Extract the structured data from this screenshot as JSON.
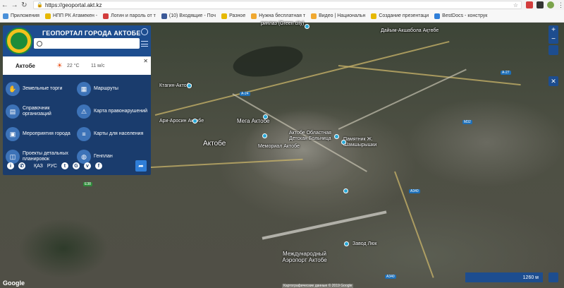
{
  "browser": {
    "url": "https://geoportal.akt.kz",
    "bookmarks": [
      {
        "label": "Приложения",
        "color": "#4a90d9"
      },
      {
        "label": "НПП РК Атамекен -",
        "color": "#e6b800"
      },
      {
        "label": "Логин и пароль от т",
        "color": "#d23c3c"
      },
      {
        "label": "(10) Входящие - Поч",
        "color": "#3b5998"
      },
      {
        "label": "Разное",
        "color": "#e6b800"
      },
      {
        "label": "Нужна бесплатная т",
        "color": "#f0a830"
      },
      {
        "label": "Видео | Национальн",
        "color": "#f0a830"
      },
      {
        "label": "Создание презентаци",
        "color": "#e6b800"
      },
      {
        "label": "BestDocs - конструк",
        "color": "#2f7ed8"
      }
    ]
  },
  "panel": {
    "title": "ГЕОПОРТАЛ ГОРОДА АКТОБЕ",
    "search_placeholder": "",
    "weather": {
      "city": "Актобе",
      "temp": "22 °C",
      "wind": "11 м/с"
    },
    "menu": [
      {
        "label": "Земельные торги",
        "icon": "hand-icon"
      },
      {
        "label": "Маршруты",
        "icon": "map-icon"
      },
      {
        "label": "Справочник организаций",
        "icon": "book-icon"
      },
      {
        "label": "Карта правонарушений",
        "icon": "warning-icon"
      },
      {
        "label": "Мероприятия города",
        "icon": "calendar-icon"
      },
      {
        "label": "Карты для населения",
        "icon": "list-icon"
      },
      {
        "label": "Проекты детальных планировок",
        "icon": "layers-icon"
      },
      {
        "label": "Генплан",
        "icon": "globe-icon"
      }
    ],
    "lang_kz": "ҚАЗ",
    "lang_ru": "РУС"
  },
  "map": {
    "scale": "1260 м",
    "google": "Google",
    "copyright": "Картографические данные © 2019 Google",
    "labels": {
      "city": "Актобе",
      "airport": "Международный Аэропорт Актобе",
      "mega": "Мега Актобе",
      "hospital": "Актобе Областная Детская Больница",
      "tsum": "Памятник Ж. Шамшырышки",
      "memorial": "Мемориал Актобе",
      "afrosin": "Ари-Аросин Актобе",
      "ktagin": "Ктагин-Актобе",
      "zavod": "Завод Люк",
      "akshanbola": "Дайым-Акшабола Ақтөбе",
      "greencity": "ринлаз (Green city)"
    }
  }
}
